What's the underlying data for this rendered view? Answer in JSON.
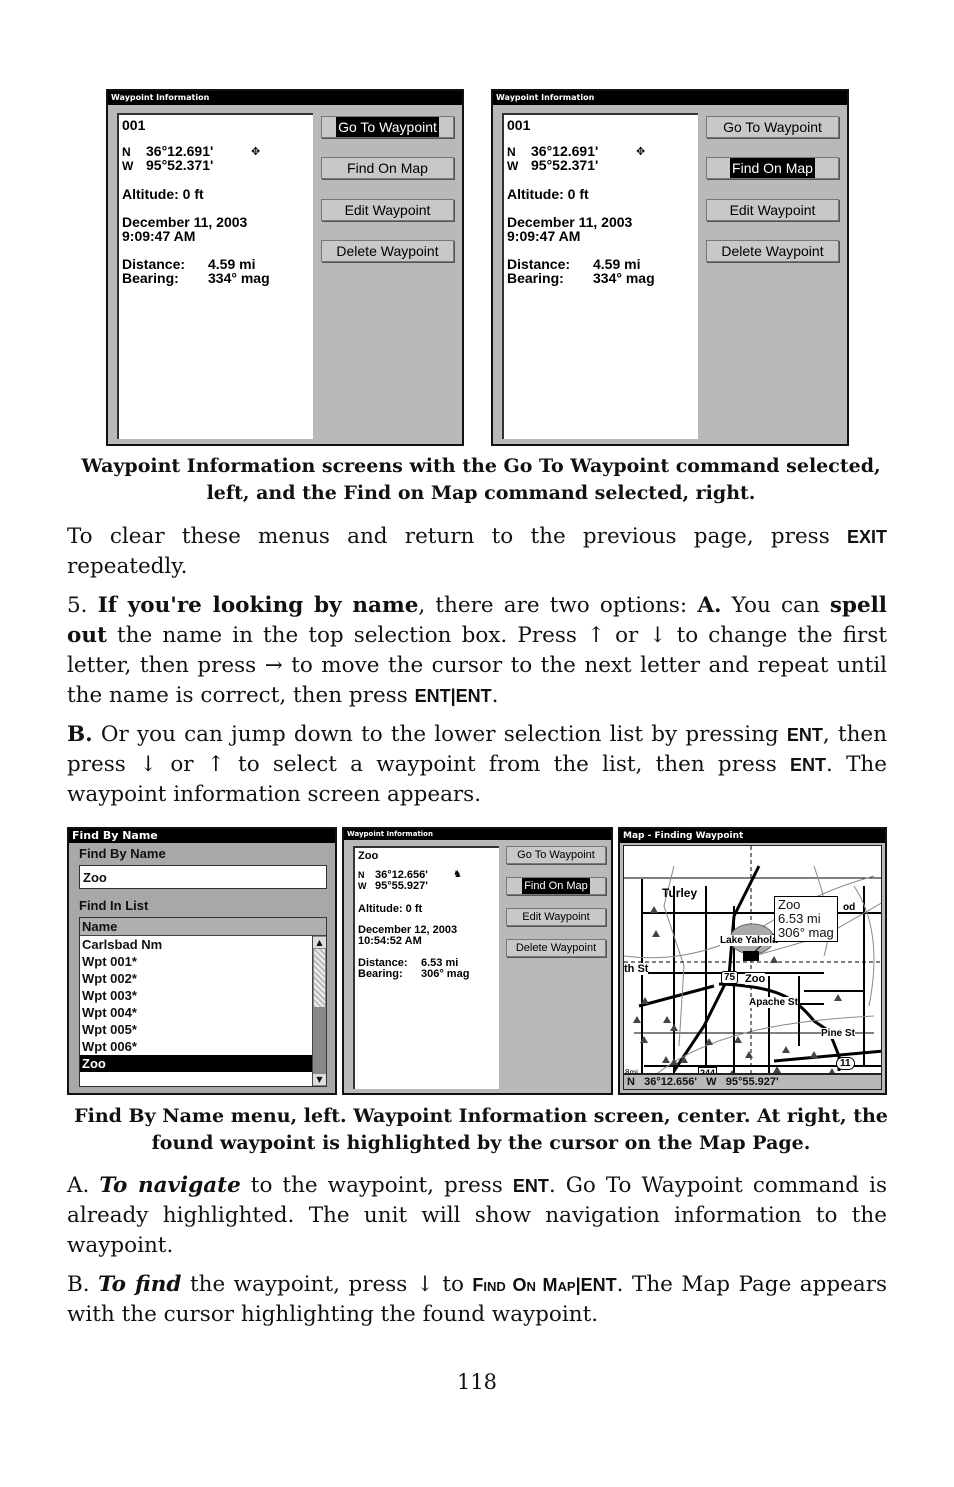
{
  "top_screens": [
    {
      "title": "Waypoint Information",
      "name": "001",
      "lat_prefix": "N",
      "lat": "36°12.691'",
      "lon_prefix": "W",
      "lon": "95°52.371'",
      "icon": "waypoint-diamond-icon",
      "altitude": "Altitude: 0 ft",
      "date": "December 11, 2003",
      "time": "9:09:47 AM",
      "distance_label": "Distance:",
      "distance": "4.59 mi",
      "bearing_label": "Bearing:",
      "bearing": "334° mag",
      "buttons": [
        "Go To Waypoint",
        "Find On Map",
        "Edit Waypoint",
        "Delete Waypoint"
      ],
      "selected_button": 0
    },
    {
      "title": "Waypoint Information",
      "name": "001",
      "lat_prefix": "N",
      "lat": "36°12.691'",
      "lon_prefix": "W",
      "lon": "95°52.371'",
      "icon": "waypoint-diamond-icon",
      "altitude": "Altitude: 0 ft",
      "date": "December 11, 2003",
      "time": "9:09:47 AM",
      "distance_label": "Distance:",
      "distance": "4.59 mi",
      "bearing_label": "Bearing:",
      "bearing": "334° mag",
      "buttons": [
        "Go To Waypoint",
        "Find On Map",
        "Edit Waypoint",
        "Delete Waypoint"
      ],
      "selected_button": 1
    }
  ],
  "caption1": "Waypoint Information screens with the Go To Waypoint command selected, left, and the Find on Map command selected, right.",
  "para1": {
    "text_a": "To clear these menus and return to the previous page, press ",
    "key": "EXIT",
    "text_b": " repeatedly."
  },
  "para2": {
    "num": "5. ",
    "bold1": "If you're looking by name",
    "t1": ", there are two options: ",
    "bold2": "A.",
    "t2": " You can ",
    "bold3": "spell out",
    "t3": " the name in the top selection box. Press ",
    "up": "↑",
    "t4": " or ",
    "down": "↓",
    "t5": " to change the first letter, then press ",
    "right": "→",
    "t6": " to move the cursor to the next letter and repeat until the name is correct, then press ",
    "key": "ENT|ENT",
    "t7": "."
  },
  "para3": {
    "bold": "B.",
    "t1": " Or you can jump down to the lower selection list by pressing ",
    "key1": "ENT",
    "t2": ", then press ",
    "down": "↓",
    "t3": " or ",
    "up": "↑",
    "t4": " to select a waypoint from the list, then press ",
    "key2": "ENT",
    "t5": ". The waypoint information screen appears."
  },
  "find_by_name": {
    "title": "Find By Name",
    "label": "Find By Name",
    "input_value": "Zoo",
    "list_label": "Find In List",
    "column_header": "Name",
    "items": [
      "Carlsbad Nm",
      "Wpt 001*",
      "Wpt 002*",
      "Wpt 003*",
      "Wpt 004*",
      "Wpt 005*",
      "Wpt 006*",
      "Zoo"
    ],
    "selected_index": 7
  },
  "center_screen": {
    "title": "Waypoint Information",
    "name": "Zoo",
    "lat_prefix": "N",
    "lat": "36°12.656'",
    "lon_prefix": "W",
    "lon": "95°55.927'",
    "icon": "zoo-animal-icon",
    "altitude": "Altitude: 0 ft",
    "date": "December 12, 2003",
    "time": "10:54:52 AM",
    "distance_label": "Distance:",
    "distance": "6.53 mi",
    "bearing_label": "Bearing:",
    "bearing": "306° mag",
    "buttons": [
      "Go To Waypoint",
      "Find On Map",
      "Edit Waypoint",
      "Delete Waypoint"
    ],
    "selected_button": 1
  },
  "map_screen": {
    "title": "Map - Finding Waypoint",
    "labels": {
      "turley": "Turley",
      "lake": "Lake Yahola",
      "th_st": "th St",
      "hwy75": "75",
      "zoo": "Zoo",
      "apache": "Apache St",
      "pine": "Pine St",
      "hwy11": "11",
      "hwy244": "244",
      "scale": "8mi",
      "rd": "od"
    },
    "popup": [
      "Zoo",
      "6.53 mi",
      "306° mag"
    ],
    "status": "N   36°12.656'   W   95°55.927'"
  },
  "caption2": "Find By Name menu, left. Waypoint Information screen, center. At right, the found waypoint is highlighted by the cursor on the Map Page.",
  "para4": {
    "a": "A. ",
    "em": "To navigate",
    "t1": " to the waypoint, press ",
    "key": "ENT",
    "t2": ". Go To Waypoint command is already highlighted. The unit will show navigation information to the waypoint."
  },
  "para5": {
    "b": "B. ",
    "em": "To find",
    "t1": " the waypoint, press ",
    "down": "↓",
    "t2": " to ",
    "sc": "Find On Map",
    "key": "|ENT",
    "t3": ". The Map Page appears with the cursor highlighting the found waypoint."
  },
  "page_number": "118"
}
